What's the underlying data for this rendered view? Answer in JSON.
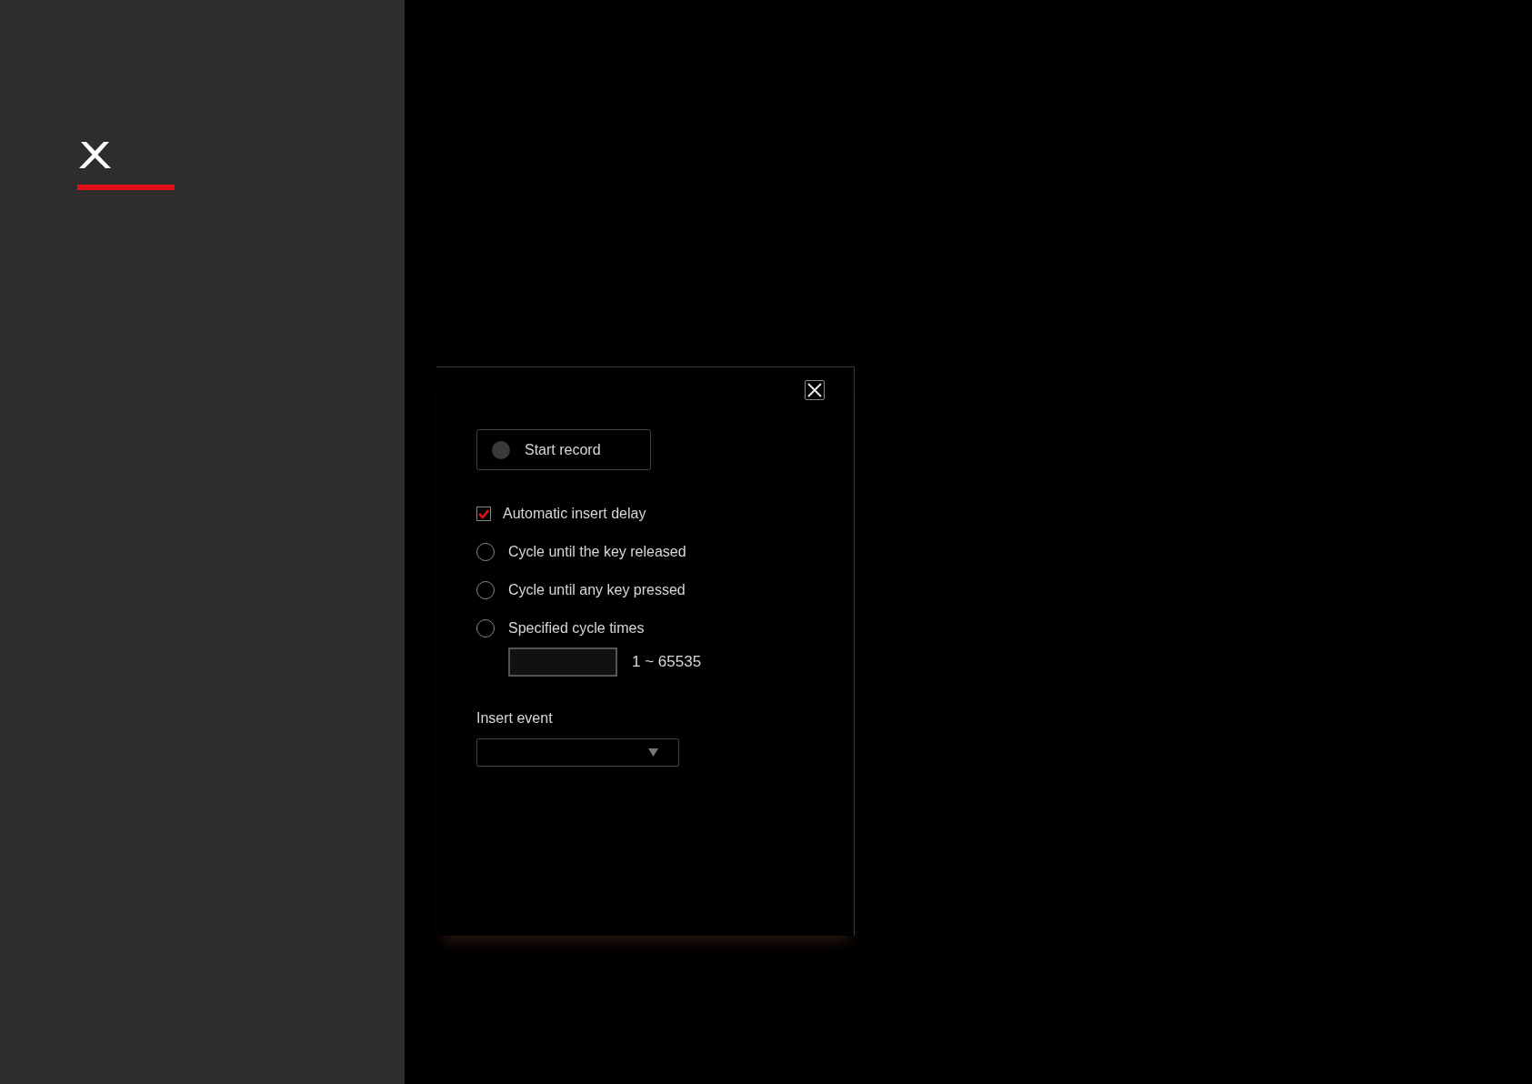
{
  "dialog": {
    "record_button": {
      "label": "Start record",
      "recording": false
    },
    "options": [
      {
        "kind": "checkbox",
        "label": "Automatic insert delay",
        "checked": true
      },
      {
        "kind": "radio",
        "label": "Cycle until the key released",
        "selected": false
      },
      {
        "kind": "radio",
        "label": "Cycle until any key pressed",
        "selected": false
      },
      {
        "kind": "radio",
        "label": "Specified cycle times",
        "selected": false
      }
    ],
    "cycle_range": "1 ~ 65535",
    "insert_event": {
      "label": "Insert event"
    }
  }
}
